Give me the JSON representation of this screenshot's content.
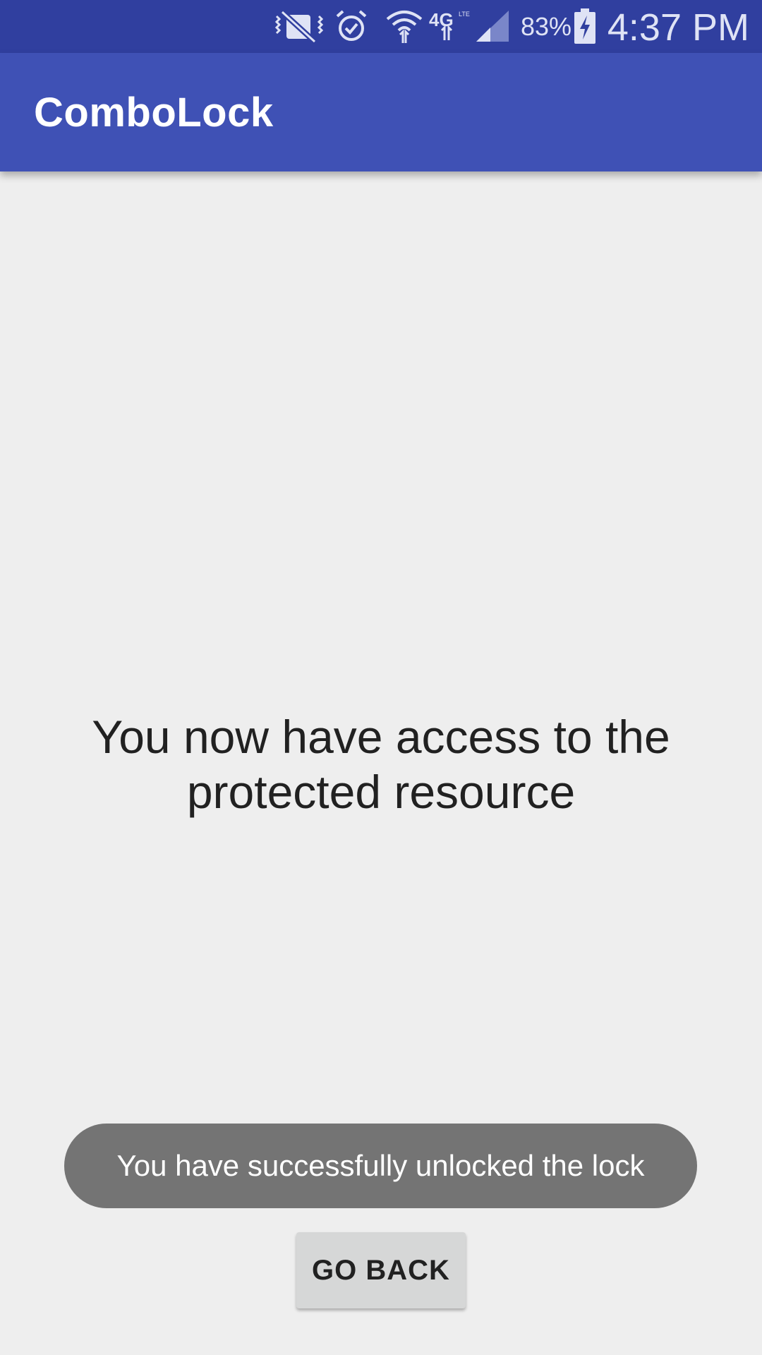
{
  "status_bar": {
    "battery_percent": "83%",
    "time": "4:37 PM",
    "icons": [
      "vibrate-mute-icon",
      "alarm-icon",
      "wifi-icon",
      "4g-lte-icon",
      "signal-icon",
      "battery-charging-icon"
    ],
    "background_color": "#303f9f"
  },
  "app_bar": {
    "title": "ComboLock",
    "background_color": "#3f51b5"
  },
  "main": {
    "message": "You now have access to the protected resource"
  },
  "toast": {
    "text": "You have successfully unlocked the lock"
  },
  "actions": {
    "go_back_label": "GO BACK"
  }
}
